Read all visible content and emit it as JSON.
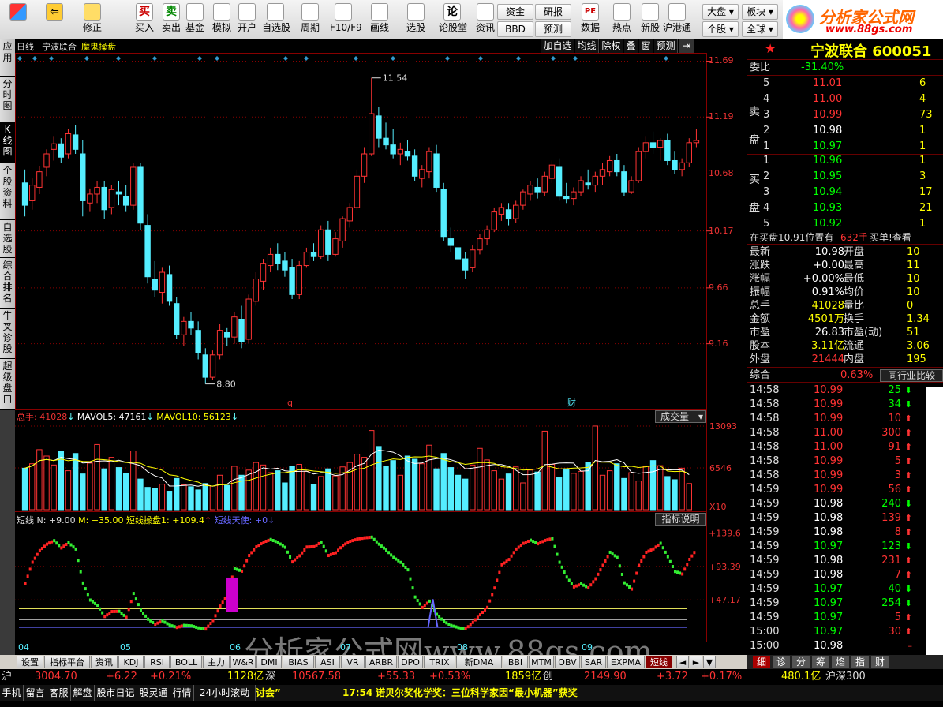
{
  "toolbar": {
    "left": [
      {
        "label": "",
        "icon": "grid-icon"
      },
      {
        "label": "",
        "icon": "back-arrow-icon"
      },
      {
        "label": "修正",
        "icon": "refresh-icon"
      },
      {
        "label": "买入",
        "icon": "buy-icon",
        "glyph": "买"
      },
      {
        "label": "卖出",
        "icon": "sell-icon",
        "glyph": "卖"
      },
      {
        "label": "基金",
        "icon": "fund-icon"
      },
      {
        "label": "模拟",
        "icon": "hammer-icon"
      },
      {
        "label": "开户",
        "icon": "lock-icon"
      },
      {
        "label": "自选股",
        "icon": "star-icon"
      },
      {
        "label": "周期",
        "icon": "clock-icon"
      },
      {
        "label": "F10/F9",
        "icon": "f10-icon"
      },
      {
        "label": "画线",
        "icon": "pencil-icon"
      },
      {
        "label": "选股",
        "icon": "stock-pick-icon"
      },
      {
        "label": "论股堂",
        "icon": "forum-icon",
        "glyph": "论"
      },
      {
        "label": "资讯",
        "icon": "news-icon"
      }
    ],
    "pair": [
      {
        "top": "资金",
        "bottom": "BBD"
      },
      {
        "top": "研报",
        "bottom": "预测"
      }
    ],
    "right": [
      {
        "label": "数据",
        "icon": "pe-icon",
        "glyph": "PE"
      },
      {
        "label": "热点",
        "icon": "hot-icon"
      },
      {
        "label": "新股",
        "icon": "newstock-icon"
      },
      {
        "label": "沪港通",
        "icon": "hk-icon"
      }
    ],
    "pair2": [
      {
        "top": "大盘",
        "bottom": "个股"
      },
      {
        "top": "板块",
        "bottom": "全球"
      }
    ],
    "logo_title": "分析家公式网",
    "logo_url": "www.88gs.com"
  },
  "sidebar": [
    {
      "label": "应用"
    },
    {
      "label": "分时图"
    },
    {
      "label": "K线图",
      "active": true
    },
    {
      "label": "个股资料"
    },
    {
      "label": "自选股"
    },
    {
      "label": "综合排名"
    },
    {
      "label": "牛叉诊股"
    },
    {
      "label": "超级盘口"
    }
  ],
  "chart": {
    "period": "日线",
    "stock_name": "宁波联合",
    "indicator_name": "魔鬼操盘",
    "buttons": [
      "加自选",
      "均线",
      "除权",
      "叠",
      "窗",
      "预测"
    ],
    "price_ticks": [
      "11.69",
      "11.19",
      "10.68",
      "10.17",
      "9.66",
      "9.16"
    ],
    "high_label": "11.54",
    "low_label": "8.80",
    "event_q": "q",
    "event_cai": "财",
    "vol_header": {
      "total": "总手: 41028",
      "mavol5": "MAVOL5: 47161",
      "mavol10": "MAVOL10: 56123"
    },
    "vol_select": "成交量",
    "vol_ticks": [
      "13093",
      "6546",
      "X10"
    ],
    "ind_header": {
      "name": "短线",
      "n": "N: +9.00",
      "m": "M: +35.00",
      "s1": "短线操盘1: +109.4",
      "s2": "短线天使: +0"
    },
    "ind_button": "指标说明",
    "ind_ticks": [
      "+139.6",
      "+93.39",
      "+47.17"
    ],
    "months": [
      "04",
      "05",
      "06",
      "07",
      "08",
      "09"
    ],
    "watermark": "分析家公式网www.88gs.com"
  },
  "chart_data": {
    "type": "candlestick",
    "ohlc": [
      [
        10.6,
        10.72,
        10.3,
        10.4
      ],
      [
        10.44,
        10.64,
        10.36,
        10.58
      ],
      [
        10.56,
        10.75,
        10.5,
        10.7
      ],
      [
        10.74,
        10.9,
        10.66,
        10.86
      ],
      [
        10.9,
        11.02,
        10.8,
        10.95
      ],
      [
        10.95,
        11.0,
        10.78,
        10.83
      ],
      [
        10.86,
        11.08,
        10.82,
        11.04
      ],
      [
        11.03,
        11.12,
        10.86,
        10.9
      ],
      [
        10.86,
        10.98,
        10.3,
        10.44
      ],
      [
        10.42,
        10.55,
        10.34,
        10.5
      ],
      [
        10.5,
        10.62,
        10.42,
        10.56
      ],
      [
        10.56,
        10.62,
        10.28,
        10.36
      ],
      [
        10.38,
        10.58,
        10.32,
        10.54
      ],
      [
        10.52,
        10.62,
        10.4,
        10.5
      ],
      [
        10.48,
        10.58,
        10.34,
        10.4
      ],
      [
        10.4,
        10.78,
        10.36,
        10.74
      ],
      [
        10.74,
        10.78,
        10.18,
        10.24
      ],
      [
        10.22,
        10.32,
        9.7,
        9.76
      ],
      [
        9.74,
        9.9,
        9.58,
        9.64
      ],
      [
        9.62,
        9.84,
        9.52,
        9.8
      ],
      [
        9.78,
        9.86,
        9.5,
        9.54
      ],
      [
        9.52,
        9.58,
        9.2,
        9.24
      ],
      [
        9.24,
        9.4,
        9.14,
        9.36
      ],
      [
        9.36,
        9.44,
        9.24,
        9.3
      ],
      [
        9.28,
        9.36,
        9.02,
        9.08
      ],
      [
        9.06,
        9.12,
        8.8,
        8.86
      ],
      [
        8.86,
        9.1,
        8.84,
        9.06
      ],
      [
        9.06,
        9.34,
        9.02,
        9.28
      ],
      [
        9.26,
        9.3,
        9.14,
        9.22
      ],
      [
        9.22,
        9.44,
        9.16,
        9.4
      ],
      [
        9.38,
        9.5,
        9.12,
        9.18
      ],
      [
        9.2,
        9.6,
        9.16,
        9.56
      ],
      [
        9.54,
        9.8,
        9.5,
        9.74
      ],
      [
        9.72,
        9.92,
        9.64,
        9.88
      ],
      [
        9.86,
        10.02,
        9.8,
        9.96
      ],
      [
        9.96,
        10.06,
        9.82,
        9.88
      ],
      [
        9.9,
        9.98,
        9.76,
        9.82
      ],
      [
        9.84,
        9.92,
        9.56,
        9.6
      ],
      [
        9.6,
        9.9,
        9.56,
        9.86
      ],
      [
        9.86,
        10.02,
        9.84,
        9.98
      ],
      [
        9.98,
        10.06,
        9.9,
        9.94
      ],
      [
        9.94,
        10.22,
        9.92,
        10.18
      ],
      [
        10.18,
        10.26,
        9.9,
        9.96
      ],
      [
        9.96,
        10.16,
        9.94,
        10.1
      ],
      [
        10.08,
        10.3,
        10.02,
        10.28
      ],
      [
        10.26,
        10.42,
        10.2,
        10.38
      ],
      [
        10.38,
        10.72,
        10.36,
        10.66
      ],
      [
        10.66,
        10.92,
        10.6,
        10.86
      ],
      [
        10.86,
        11.54,
        10.84,
        11.22
      ],
      [
        11.2,
        11.28,
        10.92,
        11.0
      ],
      [
        11.0,
        11.14,
        10.9,
        10.94
      ],
      [
        10.94,
        11.08,
        10.82,
        10.86
      ],
      [
        10.86,
        10.96,
        10.76,
        10.9
      ],
      [
        10.88,
        10.98,
        10.8,
        10.84
      ],
      [
        10.84,
        10.9,
        10.62,
        10.66
      ],
      [
        10.64,
        10.76,
        10.56,
        10.72
      ],
      [
        10.7,
        10.92,
        10.64,
        10.88
      ],
      [
        10.86,
        10.94,
        10.52,
        10.56
      ],
      [
        10.54,
        10.6,
        10.08,
        10.12
      ],
      [
        10.1,
        10.2,
        9.98,
        10.04
      ],
      [
        10.02,
        10.08,
        9.86,
        9.92
      ],
      [
        9.92,
        9.98,
        9.74,
        9.82
      ],
      [
        9.84,
        10.04,
        9.8,
        10.0
      ],
      [
        10.0,
        10.14,
        9.96,
        10.1
      ],
      [
        10.1,
        10.22,
        10.04,
        10.18
      ],
      [
        10.18,
        10.38,
        10.16,
        10.34
      ],
      [
        10.32,
        10.42,
        10.26,
        10.38
      ],
      [
        10.36,
        10.42,
        10.22,
        10.28
      ],
      [
        10.28,
        10.44,
        10.24,
        10.4
      ],
      [
        10.4,
        10.54,
        10.36,
        10.52
      ],
      [
        10.5,
        10.62,
        10.44,
        10.58
      ],
      [
        10.56,
        10.64,
        10.46,
        10.52
      ],
      [
        10.52,
        10.7,
        10.48,
        10.66
      ],
      [
        10.64,
        10.8,
        10.6,
        10.76
      ],
      [
        10.74,
        10.82,
        10.44,
        10.48
      ],
      [
        10.48,
        10.6,
        10.42,
        10.46
      ],
      [
        10.46,
        10.56,
        10.4,
        10.52
      ],
      [
        10.52,
        10.66,
        10.48,
        10.62
      ],
      [
        10.6,
        10.72,
        10.54,
        10.58
      ],
      [
        10.58,
        10.7,
        10.52,
        10.66
      ],
      [
        10.66,
        10.78,
        10.58,
        10.72
      ],
      [
        10.7,
        10.84,
        10.66,
        10.8
      ],
      [
        10.8,
        10.86,
        10.66,
        10.7
      ],
      [
        10.7,
        10.76,
        10.48,
        10.52
      ],
      [
        10.52,
        10.66,
        10.5,
        10.62
      ],
      [
        10.62,
        10.92,
        10.6,
        10.88
      ],
      [
        10.88,
        11.02,
        10.82,
        10.96
      ],
      [
        10.96,
        11.06,
        10.86,
        10.92
      ],
      [
        10.92,
        11.0,
        10.8,
        10.98
      ],
      [
        10.98,
        11.04,
        10.76,
        10.8
      ],
      [
        10.8,
        10.88,
        10.68,
        10.72
      ],
      [
        10.72,
        10.82,
        10.66,
        10.78
      ],
      [
        10.78,
        11.0,
        10.74,
        10.96
      ],
      [
        10.96,
        11.08,
        10.92,
        10.98
      ]
    ],
    "volume": [
      6500,
      7200,
      9400,
      8400,
      7000,
      9100,
      6100,
      8800,
      5600,
      7300,
      10200,
      6400,
      8200,
      6600,
      5700,
      9200,
      4800,
      3500,
      3300,
      4000,
      2900,
      4900,
      3900,
      3600,
      3100,
      4100,
      3700,
      5400,
      3800,
      6800,
      5400,
      6200,
      7400,
      7000,
      5800,
      6100,
      4200,
      6800,
      7100,
      6000,
      3900,
      5200,
      6400,
      5300,
      6700,
      7400,
      8700,
      8200,
      12400,
      9900,
      6800,
      7700,
      5400,
      8400,
      7900,
      7200,
      10100,
      6400,
      8800,
      6600,
      5400,
      4800,
      7000,
      9600,
      7800,
      6100,
      4800,
      5600,
      6700,
      4200,
      6200,
      5900,
      12300,
      7100,
      5000,
      6400,
      5700,
      6000,
      7400,
      13100,
      5400,
      6100,
      7200,
      4900,
      5800,
      4500,
      6800,
      7700,
      6900,
      5200,
      4700,
      6500,
      4100
    ],
    "mavol5": 47161,
    "mavol10": 56123,
    "indicator": {
      "short_line_op1": 109.4,
      "short_line_angel": 0,
      "N": 9,
      "M": 35
    },
    "ylim": [
      8.8,
      11.69
    ],
    "volume_max": 13093
  },
  "right": {
    "stock_title": "宁波联合 600051",
    "weibi_label": "委比",
    "weibi_val": "-31.40%",
    "sell_label": "卖盘",
    "buy_label": "买盘",
    "sell": [
      {
        "n": "5",
        "p": "11.01",
        "v": "6"
      },
      {
        "n": "4",
        "p": "11.00",
        "v": "4"
      },
      {
        "n": "3",
        "p": "10.99",
        "v": "73"
      },
      {
        "n": "2",
        "p": "10.98",
        "v": "1"
      },
      {
        "n": "1",
        "p": "10.97",
        "v": "1"
      }
    ],
    "buy": [
      {
        "n": "1",
        "p": "10.96",
        "v": "1"
      },
      {
        "n": "2",
        "p": "10.95",
        "v": "3"
      },
      {
        "n": "3",
        "p": "10.94",
        "v": "17"
      },
      {
        "n": "4",
        "p": "10.93",
        "v": "21"
      },
      {
        "n": "5",
        "p": "10.92",
        "v": "1"
      }
    ],
    "buy_line": "在买盘10.91位置有",
    "buy_qty": "632手",
    "buy_btn": "买单!查看",
    "stats": [
      {
        "l": "最新",
        "v": "10.98",
        "l2": "开盘",
        "v2": "10"
      },
      {
        "l": "涨跌",
        "v": "+0.00",
        "l2": "最高",
        "v2": "11"
      },
      {
        "l": "涨幅",
        "v": "+0.00%",
        "l2": "最低",
        "v2": "10"
      },
      {
        "l": "振幅",
        "v": "0.91%",
        "l2": "均价",
        "v2": "10"
      },
      {
        "l": "总手",
        "v": "41028",
        "l2": "量比",
        "v2": "0"
      },
      {
        "l": "金额",
        "v": "4501万",
        "l2": "换手",
        "v2": "1.34"
      },
      {
        "l": "市盈",
        "v": "26.83",
        "l2": "市盈(动)",
        "v2": "51"
      },
      {
        "l": "股本",
        "v": "3.11亿",
        "l2": "流通",
        "v2": "3.06"
      },
      {
        "l": "外盘",
        "v": "21444",
        "l2": "内盘",
        "v2": "195"
      }
    ],
    "zonghe": "综合",
    "zonghe_val": "0.63%",
    "tongbi": "同行业比较",
    "ticks": [
      {
        "t": "14:58",
        "p": "10.99",
        "v": "25",
        "d": "down"
      },
      {
        "t": "14:58",
        "p": "10.99",
        "v": "34",
        "d": "down"
      },
      {
        "t": "14:58",
        "p": "10.99",
        "v": "10",
        "d": "up"
      },
      {
        "t": "14:58",
        "p": "11.00",
        "v": "300",
        "d": "up"
      },
      {
        "t": "14:58",
        "p": "11.00",
        "v": "91",
        "d": "up"
      },
      {
        "t": "14:58",
        "p": "10.99",
        "v": "5",
        "d": "up"
      },
      {
        "t": "14:58",
        "p": "10.99",
        "v": "3",
        "d": "up"
      },
      {
        "t": "14:59",
        "p": "10.99",
        "v": "56",
        "d": "up"
      },
      {
        "t": "14:59",
        "p": "10.98",
        "v": "240",
        "d": "down"
      },
      {
        "t": "14:59",
        "p": "10.98",
        "v": "139",
        "d": "up"
      },
      {
        "t": "14:59",
        "p": "10.98",
        "v": "8",
        "d": "up"
      },
      {
        "t": "14:59",
        "p": "10.97",
        "v": "123",
        "d": "down"
      },
      {
        "t": "14:59",
        "p": "10.98",
        "v": "231",
        "d": "up"
      },
      {
        "t": "14:59",
        "p": "10.98",
        "v": "7",
        "d": "up"
      },
      {
        "t": "14:59",
        "p": "10.97",
        "v": "40",
        "d": "down"
      },
      {
        "t": "14:59",
        "p": "10.97",
        "v": "254",
        "d": "down"
      },
      {
        "t": "14:59",
        "p": "10.97",
        "v": "5",
        "d": "up"
      },
      {
        "t": "15:00",
        "p": "10.97",
        "v": "30",
        "d": "up"
      },
      {
        "t": "15:00",
        "p": "10.98",
        "v": "",
        "d": "dash"
      }
    ],
    "rtabs": [
      "细",
      "诊",
      "分",
      "筹",
      "焰",
      "指",
      "财"
    ]
  },
  "bottom_tabs": [
    "设置",
    "指标平台",
    "资讯",
    "KDJ",
    "RSI",
    "BOLL",
    "主力",
    "W&R",
    "DMI",
    "BIAS",
    "ASI",
    "VR",
    "ARBR",
    "DPO",
    "TRIX",
    "新DMA",
    "BBI",
    "MTM",
    "OBV",
    "SAR",
    "EXPMA",
    "短线"
  ],
  "status": {
    "sh": "沪",
    "sh_idx": "3004.70",
    "sh_chg": "+6.22",
    "sh_pct": "+0.21%",
    "sh_amt": "1128亿",
    "sz": "深",
    "sz_idx": "10567.58",
    "sz_chg": "+55.33",
    "sz_pct": "+0.53%",
    "sz_amt": "1859亿",
    "cy": "创",
    "cy_idx": "2149.90",
    "cy_chg": "+3.72",
    "cy_pct": "+0.17%",
    "hs_amt": "480.1亿",
    "hs": "沪深300"
  },
  "status2": {
    "items": [
      "手机",
      "留言",
      "客服",
      "解盘",
      "股市日记",
      "股灵通",
      "行情",
      "24小时滚动"
    ],
    "news1": "讨会”",
    "time": "17:54",
    "news2": "诺贝尔奖化学奖：三位科学家因“最小机器”获奖"
  }
}
